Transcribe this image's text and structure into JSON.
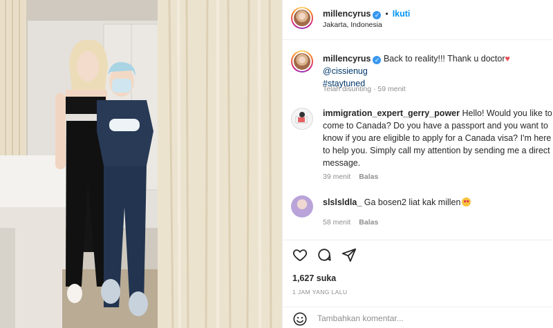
{
  "post": {
    "username": "millencyrus",
    "follow_label": "Ikuti",
    "location": "Jakarta, Indonesia",
    "caption": {
      "text": "Back to reality!!! Thank u doctor",
      "mention": "@cissienug",
      "hashtag": "#staytuned"
    },
    "edited_meta": "Telah disunting · 59 menit"
  },
  "comments": [
    {
      "username": "immigration_expert_gerry_power",
      "text": "Hello! Would you like to come to Canada? Do you have a passport and you want to know if you are eligible to apply for a Canada visa? I'm here to help you. Simply call my attention by sending me a direct message.",
      "time": "39 menit",
      "reply_label": "Balas"
    },
    {
      "username": "slslsldla_",
      "text": "Ga bosen2 liat kak millen",
      "time": "58 menit",
      "reply_label": "Balas"
    }
  ],
  "stats": {
    "likes": "1,627 suka",
    "time_ago": "1 JAM YANG LALU"
  },
  "add_comment": {
    "placeholder": "Tambahkan komentar..."
  },
  "icons": {
    "like": "heart-outline-icon",
    "comment": "speech-bubble-icon",
    "share": "paper-plane-icon",
    "emoji": "smiley-icon",
    "verified": "verified-badge-icon"
  },
  "colors": {
    "accent": "#0095f6",
    "verified": "#3897f0",
    "heart": "#ed4956",
    "muted": "#8e8e8e",
    "text": "#262626"
  }
}
